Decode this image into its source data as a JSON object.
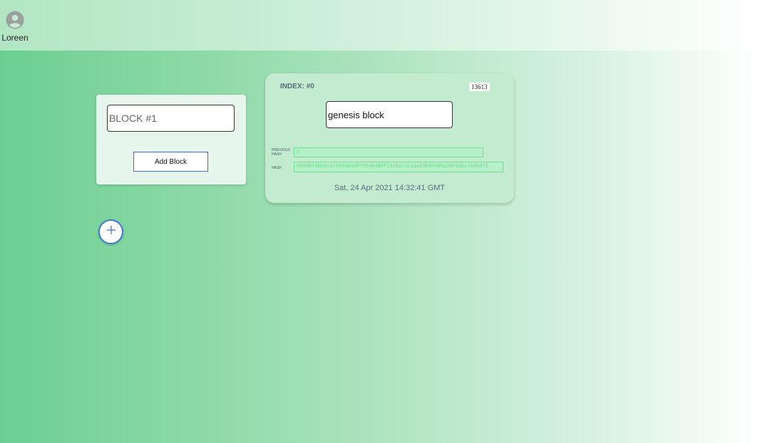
{
  "header": {
    "user": {
      "icon": "account-circle-icon",
      "name": "Loreen"
    }
  },
  "new_block": {
    "input_placeholder": "BLOCK #1",
    "add_button_label": "Add Block"
  },
  "plus_button": {
    "icon": "plus-icon",
    "label": "+"
  },
  "block": {
    "index_label": "INDEX: #0",
    "nonce": "13613",
    "data": "genesis block",
    "previous_hash_label": "PREVIOUS HASH",
    "previous_hash": "0",
    "hash_label": "HASH",
    "hash": "000d833bb4c1c994dd3d079548480f16cbac5c1aa93b00400a39fddbc7c08071",
    "timestamp": "Sat, 24 Apr 2021 14:32:41 GMT"
  },
  "colors": {
    "accent_blue": "#3b7bd6",
    "hash_green": "#6fdc8e",
    "background_start": "#6ccf91",
    "background_end": "#ffffff"
  }
}
